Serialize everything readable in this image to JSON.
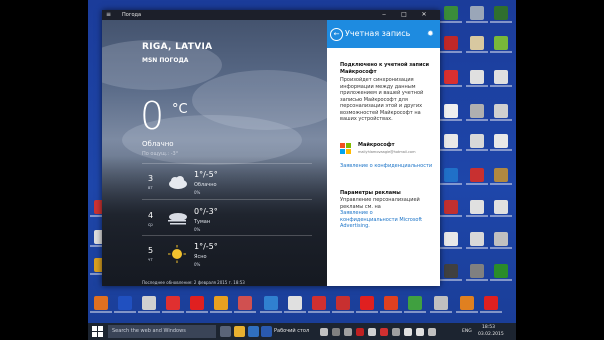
{
  "colors": {
    "desktop": "#1e46aa",
    "accent": "#1e8be0",
    "taskbar": "#1c2430",
    "link": "#1a73c7"
  },
  "window": {
    "title": "Погода",
    "menu_icon": "hamburger-icon",
    "minimize": "‒",
    "maximize": "□",
    "close": "✕"
  },
  "weather": {
    "city": "RIGA, LATVIA",
    "provider": "MSN ПОГОДА",
    "temperature": "0",
    "unit": "°C",
    "condition": "Облачно",
    "feels_like": "По ощущ.: -3°",
    "days": [
      {
        "day": "3",
        "dow": "вт",
        "temps": "1°/-5°",
        "desc": "Облачно",
        "precip": "0%",
        "icon": "cloudy-icon"
      },
      {
        "day": "4",
        "dow": "ср",
        "temps": "0°/-3°",
        "desc": "Туман",
        "precip": "0%",
        "icon": "fog-icon"
      },
      {
        "day": "5",
        "dow": "чт",
        "temps": "1°/-5°",
        "desc": "Ясно",
        "precip": "0%",
        "icon": "sun-icon"
      }
    ],
    "last_updated": "Последнее обновление: 2 февраля 2015 г. 18:53"
  },
  "account_pane": {
    "title": "Учетная запись",
    "back_icon": "back-arrow-icon",
    "connected_heading": "Подключено к учетной записи Майкрософт",
    "sync_text": "Произойдет синхронизация информации между данным приложением и вашей учетной записью Майкрософт для персонализации этой и других возможностей Майкрософт на ваших устройствах.",
    "account_name": "Майкрософт",
    "account_email": "mailyhlamovaagie@hotmail.com",
    "privacy_link": "Заявление о конфиденциальности",
    "ads_heading": "Параметры рекламы",
    "ads_text": "Управление персонализацией рекламы см. на",
    "ads_link": "Заявление о конфиденциальности Microsoft Advertising."
  },
  "taskbar": {
    "search_placeholder": "Search the web and Windows",
    "desktop_label": "Рабочий стол",
    "lang": "ENG",
    "time": "18:53",
    "date": "03.02.2015"
  }
}
